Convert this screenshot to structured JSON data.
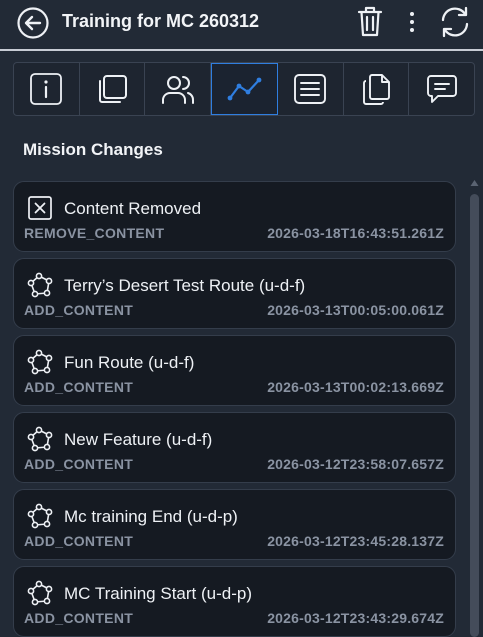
{
  "header": {
    "title": "Training for MC 260312",
    "icons": [
      "back-arrow-icon",
      "trash-icon",
      "more-vert-icon",
      "sync-icon"
    ]
  },
  "tabs": [
    {
      "icon": "info-icon",
      "active": false
    },
    {
      "icon": "copy-icon",
      "active": false
    },
    {
      "icon": "users-icon",
      "active": false
    },
    {
      "icon": "activity-chart-icon",
      "active": true
    },
    {
      "icon": "list-icon",
      "active": false
    },
    {
      "icon": "files-icon",
      "active": false
    },
    {
      "icon": "chat-icon",
      "active": false
    }
  ],
  "section": {
    "title": "Mission Changes"
  },
  "changes": [
    {
      "icon": "remove-box-icon",
      "name": "Content Removed",
      "op": "REMOVE_CONTENT",
      "ts": "2026-03-18T16:43:51.261Z"
    },
    {
      "icon": "route-icon",
      "name": "Terry’s Desert Test Route (u-d-f)",
      "op": "ADD_CONTENT",
      "ts": "2026-03-13T00:05:00.061Z"
    },
    {
      "icon": "route-icon",
      "name": "Fun Route (u-d-f)",
      "op": "ADD_CONTENT",
      "ts": "2026-03-13T00:02:13.669Z"
    },
    {
      "icon": "route-icon",
      "name": "New Feature (u-d-f)",
      "op": "ADD_CONTENT",
      "ts": "2026-03-12T23:58:07.657Z"
    },
    {
      "icon": "route-icon",
      "name": "Mc training End (u-d-p)",
      "op": "ADD_CONTENT",
      "ts": "2026-03-12T23:45:28.137Z"
    },
    {
      "icon": "route-icon",
      "name": "MC Training Start (u-d-p)",
      "op": "ADD_CONTENT",
      "ts": "2026-03-12T23:43:29.674Z"
    }
  ],
  "colors": {
    "background": "#222a36",
    "card": "#151a22",
    "accent": "#2f7ee0",
    "muted_text": "#8a93a2"
  }
}
